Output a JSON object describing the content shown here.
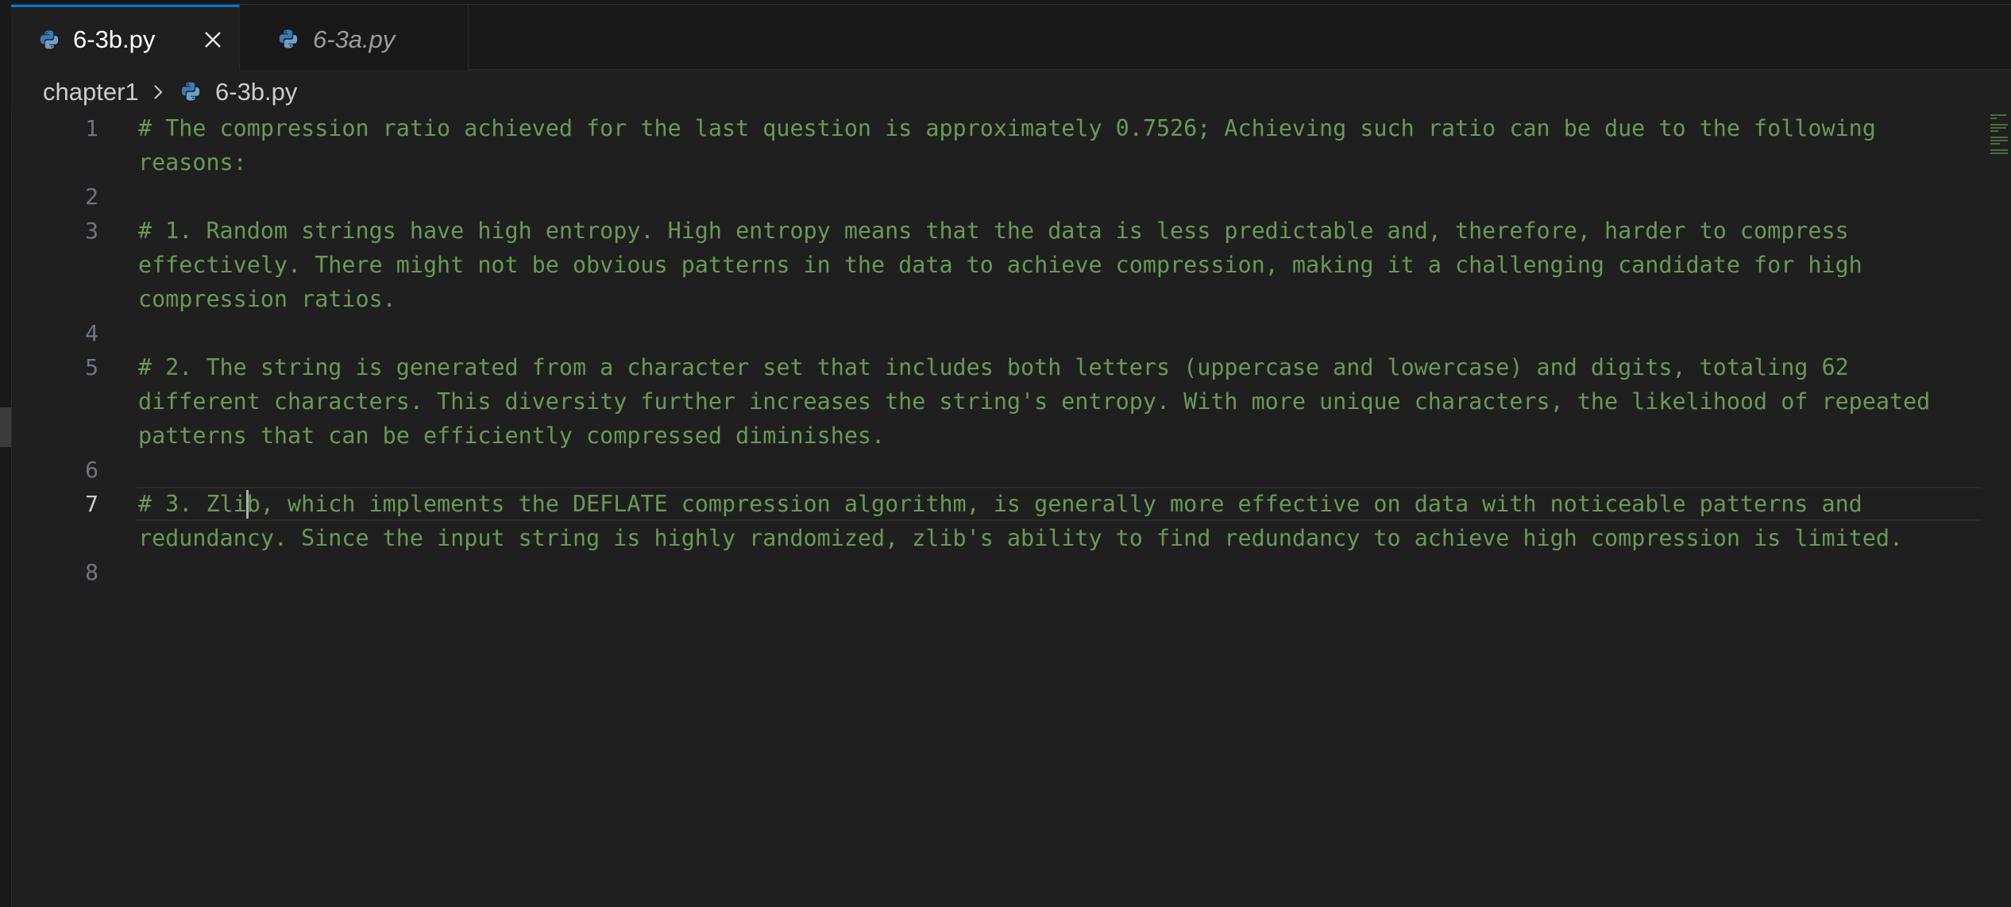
{
  "tabs": [
    {
      "label": "6-3b.py",
      "active": true
    },
    {
      "label": "6-3a.py",
      "active": false
    }
  ],
  "breadcrumb": {
    "folder": "chapter1",
    "file": "6-3b.py"
  },
  "editor": {
    "current_line": 7,
    "lines": [
      {
        "number": "1",
        "text": "# The compression ratio achieved for the last question is approximately 0.7526; Achieving such ratio can be due to the following reasons:"
      },
      {
        "number": "2",
        "text": ""
      },
      {
        "number": "3",
        "text": "# 1. Random strings have high entropy. High entropy means that the data is less predictable and, therefore, harder to compress effectively. There might not be obvious patterns in the data to achieve compression, making it a challenging candidate for high compression ratios."
      },
      {
        "number": "4",
        "text": ""
      },
      {
        "number": "5",
        "text": "# 2. The string is generated from a character set that includes both letters (uppercase and lowercase) and digits, totaling 62 different characters. This diversity further increases the string's entropy. With more unique characters, the likelihood of repeated patterns that can be efficiently compressed diminishes."
      },
      {
        "number": "6",
        "text": ""
      },
      {
        "number": "7",
        "text": "# 3. Zlib, which implements the DEFLATE compression algorithm, is generally more effective on data with noticeable patterns and redundancy. Since the input string is highly randomized, zlib's ability to find redundancy to achieve high compression is limited."
      },
      {
        "number": "8",
        "text": ""
      }
    ]
  },
  "colors": {
    "comment": "#6a9955",
    "accent": "#0078d4",
    "background": "#1f1f1f"
  },
  "icons": {
    "file_type": "python-icon",
    "close": "close-icon",
    "separator": "chevron-right-icon"
  }
}
